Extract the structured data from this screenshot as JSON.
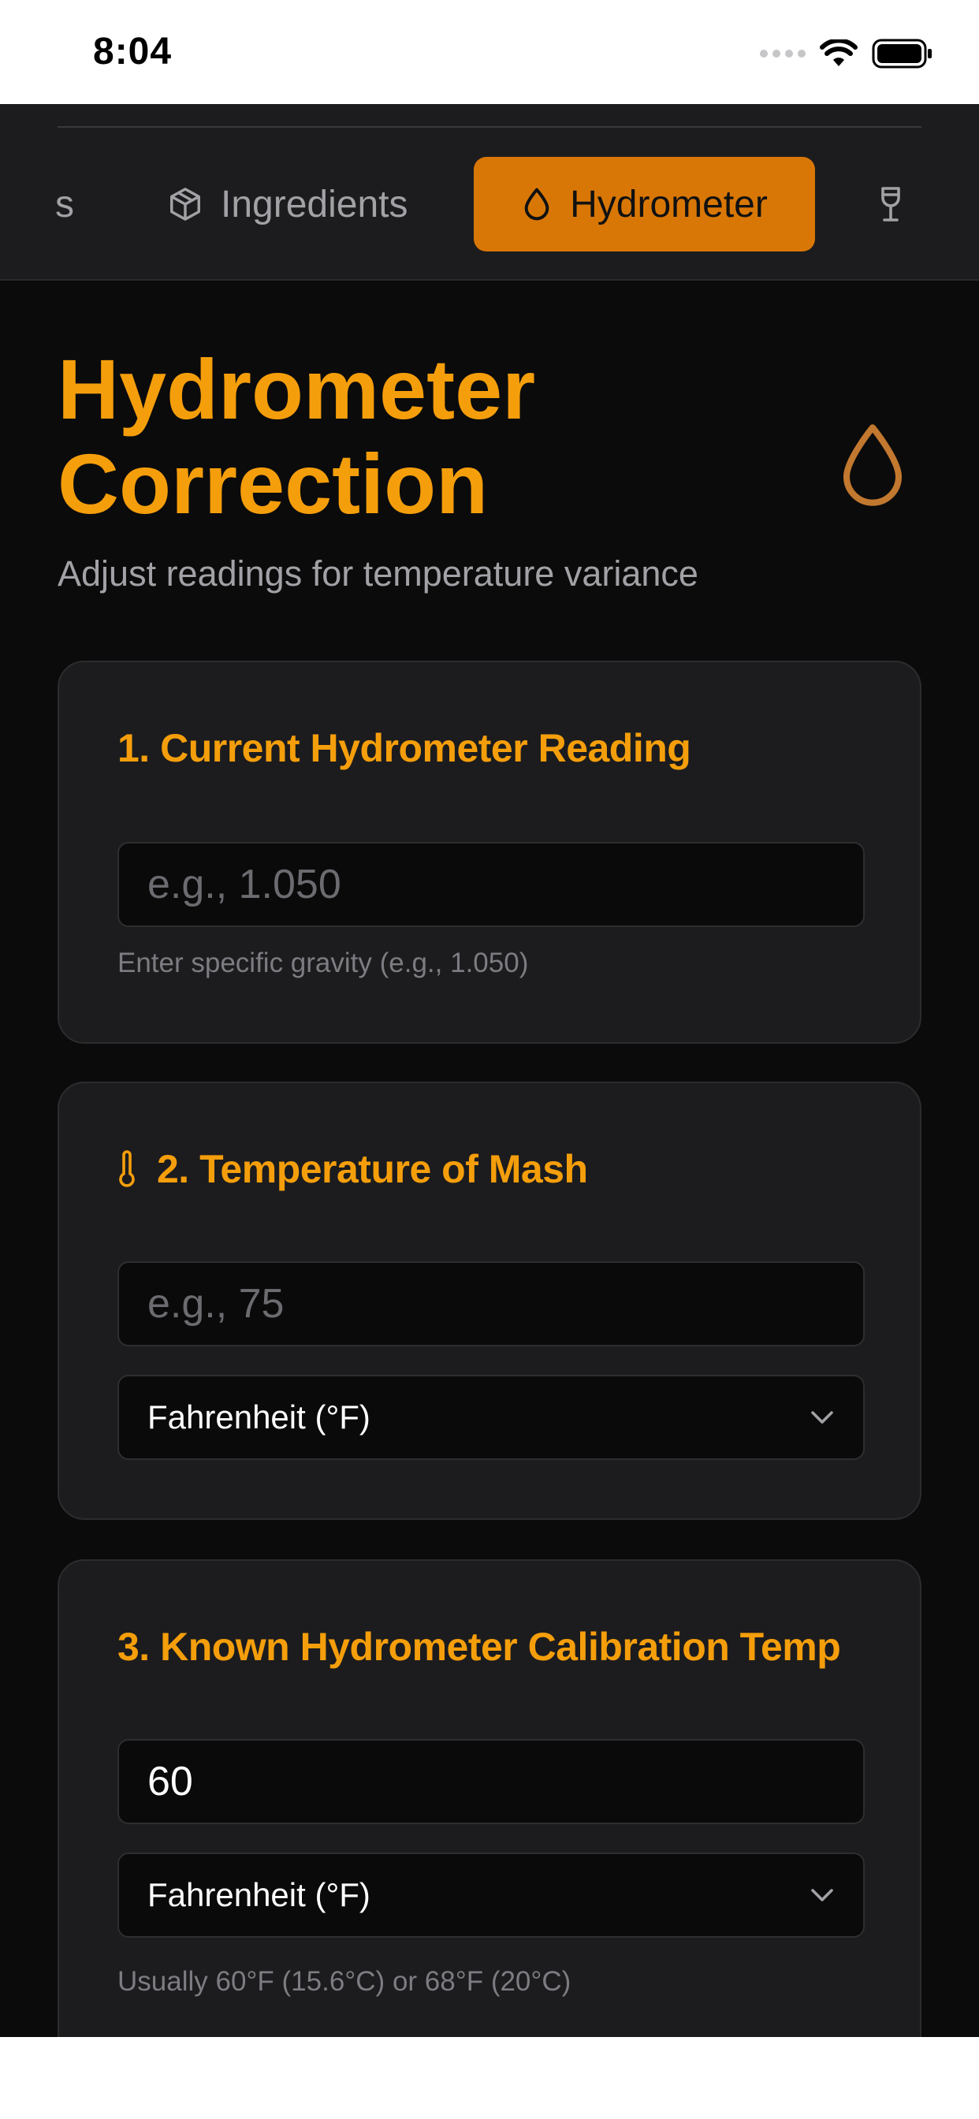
{
  "status_bar": {
    "time": "8:04"
  },
  "tabs": [
    {
      "label": "s",
      "icon": "partial-tab"
    },
    {
      "label": "Ingredients",
      "icon": "box-icon"
    },
    {
      "label": "Hydrometer",
      "icon": "droplet-icon",
      "active": true
    },
    {
      "label": "",
      "icon": "wine-glass-icon"
    }
  ],
  "header": {
    "title_line1": "Hydrometer",
    "title_line2": "Correction",
    "subtitle": "Adjust readings for temperature variance",
    "icon": "droplet-icon"
  },
  "sections": {
    "reading": {
      "title": "1. Current Hydrometer Reading",
      "placeholder": "e.g., 1.050",
      "value": "",
      "hint": "Enter specific gravity (e.g., 1.050)"
    },
    "temperature": {
      "title": "2. Temperature of Mash",
      "icon": "thermometer-icon",
      "placeholder": "e.g., 75",
      "value": "",
      "unit": "Fahrenheit (°F)"
    },
    "calibration": {
      "title": "3. Known Hydrometer Calibration Temp",
      "value": "60",
      "unit": "Fahrenheit (°F)",
      "hint": "Usually 60°F (15.6°C) or 68°F (20°C)"
    }
  },
  "colors": {
    "accent": "#f59e0b",
    "active_tab": "#d97706",
    "background": "#0b0b0c",
    "card": "#1c1c1e"
  }
}
